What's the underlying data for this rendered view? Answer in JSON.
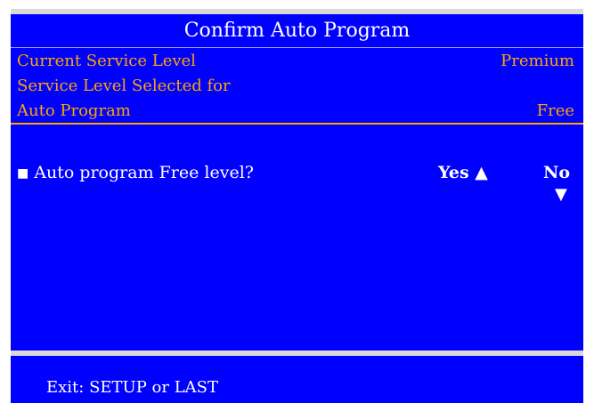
{
  "title": "Confirm Auto Program",
  "info": {
    "current_label": "Current Service Level",
    "current_value": "Premium",
    "selected_label_line1": "Service Level Selected for",
    "selected_label_line2": "Auto Program",
    "selected_value": "Free"
  },
  "prompt": {
    "bullet": "■",
    "question": "Auto program Free level?",
    "yes_label": "Yes ▲",
    "no_label": "No",
    "no_arrow": "▼"
  },
  "footer": {
    "hint": "Exit: SETUP or LAST"
  },
  "colors": {
    "panel_blue": "#0000ff",
    "accent_orange": "#ffa500",
    "strip_gray": "#d9d9d9",
    "text_white": "#ffffff"
  }
}
